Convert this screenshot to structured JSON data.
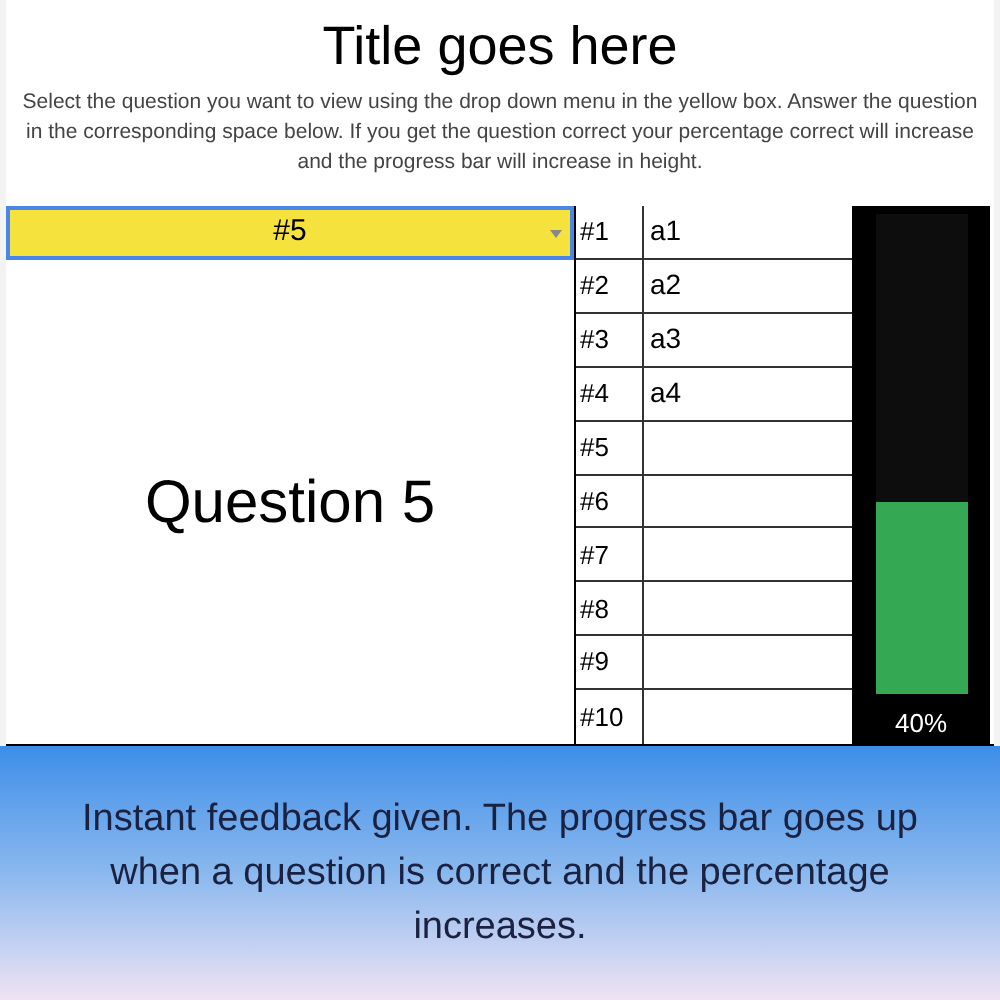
{
  "title": "Title goes here",
  "instructions": "Select the question you want to view using the drop down menu in the yellow box. Answer the question in the corresponding space below. If you get the question correct your percentage correct will increase and the progress bar will increase in height.",
  "question_select": {
    "value": "#5"
  },
  "question": "Question 5",
  "answers": [
    {
      "number": "#1",
      "answer": "a1"
    },
    {
      "number": "#2",
      "answer": "a2"
    },
    {
      "number": "#3",
      "answer": "a3"
    },
    {
      "number": "#4",
      "answer": "a4"
    },
    {
      "number": "#5"
    },
    {
      "number": "#6"
    },
    {
      "number": "#7"
    },
    {
      "number": "#8"
    },
    {
      "number": "#9"
    },
    {
      "number": "#10"
    }
  ],
  "progress": {
    "level": 0.4,
    "reading": "40%"
  },
  "caption": "Instant feedback given. The progress bar goes up when a question is correct and the percentage increases."
}
